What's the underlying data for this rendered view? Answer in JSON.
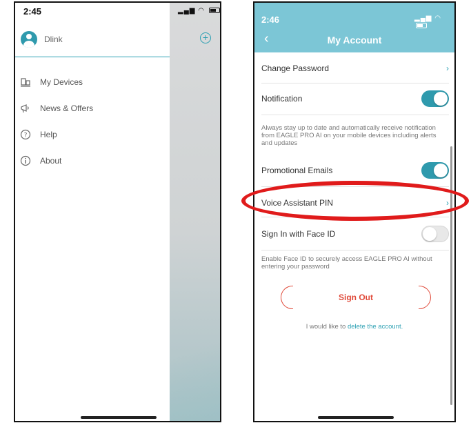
{
  "left_screen": {
    "status_time": "2:45",
    "profile_name": "Dlink",
    "menu": [
      {
        "label": "My Devices",
        "icon": "devices-icon"
      },
      {
        "label": "News & Offers",
        "icon": "megaphone-icon"
      },
      {
        "label": "Help",
        "icon": "help-icon"
      },
      {
        "label": "About",
        "icon": "info-icon"
      }
    ]
  },
  "right_screen": {
    "status_time": "2:46",
    "title": "My Account",
    "change_password": "Change Password",
    "notification": "Notification",
    "notification_on": true,
    "notification_desc": "Always stay up to date and automatically receive notification from EAGLE PRO AI on your mobile devices including alerts and updates",
    "promotional_emails": "Promotional Emails",
    "promotional_on": true,
    "voice_pin": "Voice Assistant PIN",
    "face_id": "Sign In with Face ID",
    "face_id_on": false,
    "face_id_desc": "Enable Face ID to securely access EAGLE PRO AI without entering your password",
    "sign_out": "Sign Out",
    "delete_prefix": "I would like to ",
    "delete_link": "delete the account."
  },
  "colors": {
    "accent": "#2f9aad",
    "header": "#7cc6d6",
    "sign_out": "#e04a3a",
    "highlight": "#e01b1b"
  }
}
